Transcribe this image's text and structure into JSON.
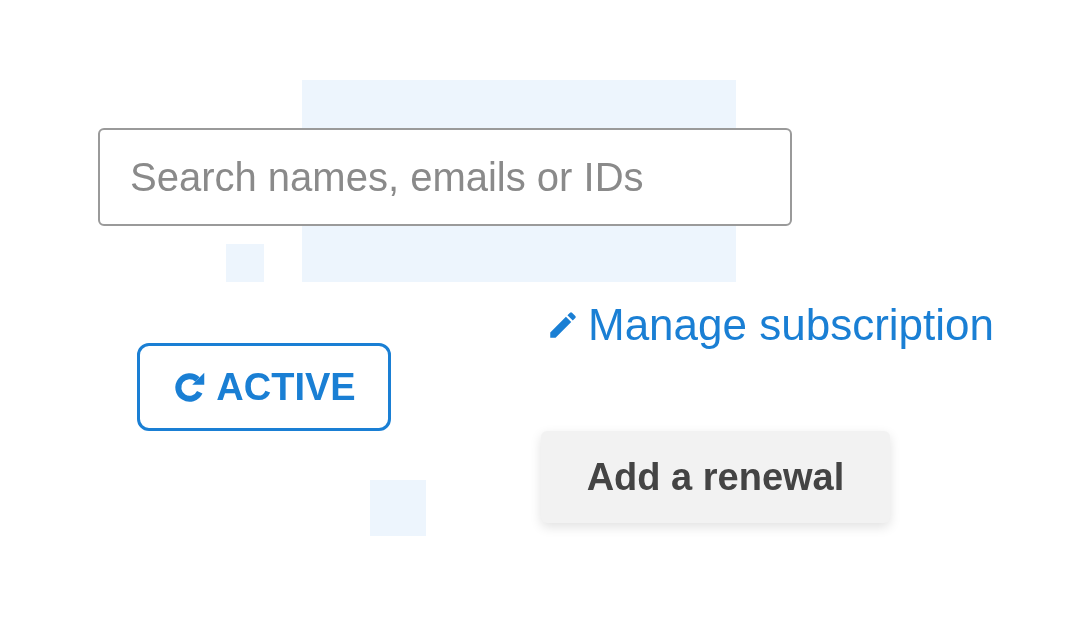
{
  "search": {
    "placeholder": "Search names, emails or IDs"
  },
  "manage_link": {
    "label": "Manage subscription"
  },
  "status_badge": {
    "label": "ACTIVE"
  },
  "renewal_button": {
    "label": "Add a renewal"
  }
}
